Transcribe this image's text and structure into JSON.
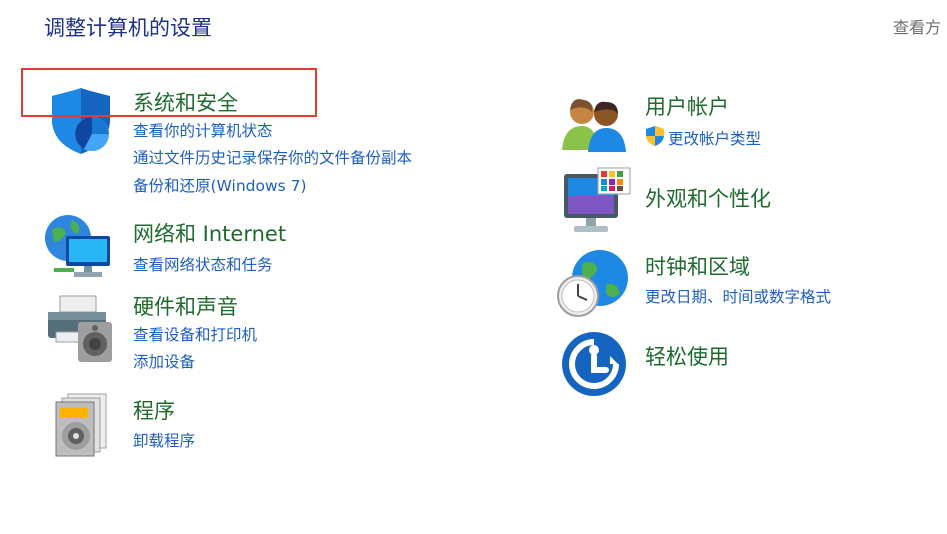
{
  "header": {
    "title": "调整计算机的设置",
    "view_by": "查看方"
  },
  "categories_left": [
    {
      "title": "系统和安全",
      "icon": "shield-icon",
      "links": [
        "查看你的计算机状态",
        "通过文件历史记录保存你的文件备份副本",
        "备份和还原(Windows 7)"
      ]
    },
    {
      "title": "网络和 Internet",
      "icon": "network-globe-icon",
      "links": [
        "查看网络状态和任务"
      ]
    },
    {
      "title": "硬件和声音",
      "icon": "printer-speaker-icon",
      "links": [
        "查看设备和打印机",
        "添加设备"
      ]
    },
    {
      "title": "程序",
      "icon": "programs-disc-icon",
      "links": [
        "卸载程序"
      ]
    }
  ],
  "categories_right": [
    {
      "title": "用户帐户",
      "icon": "users-icon",
      "links": [
        "更改帐户类型"
      ]
    },
    {
      "title": "外观和个性化",
      "icon": "monitor-palette-icon",
      "links": []
    },
    {
      "title": "时钟和区域",
      "icon": "clock-globe-icon",
      "links": [
        "更改日期、时间或数字格式"
      ]
    },
    {
      "title": "轻松使用",
      "icon": "ease-of-access-icon",
      "links": []
    }
  ],
  "colors": {
    "category_title": "#1f6b2e",
    "link": "#1f5fbf",
    "page_title": "#1e3287",
    "highlight": "#e53935"
  }
}
